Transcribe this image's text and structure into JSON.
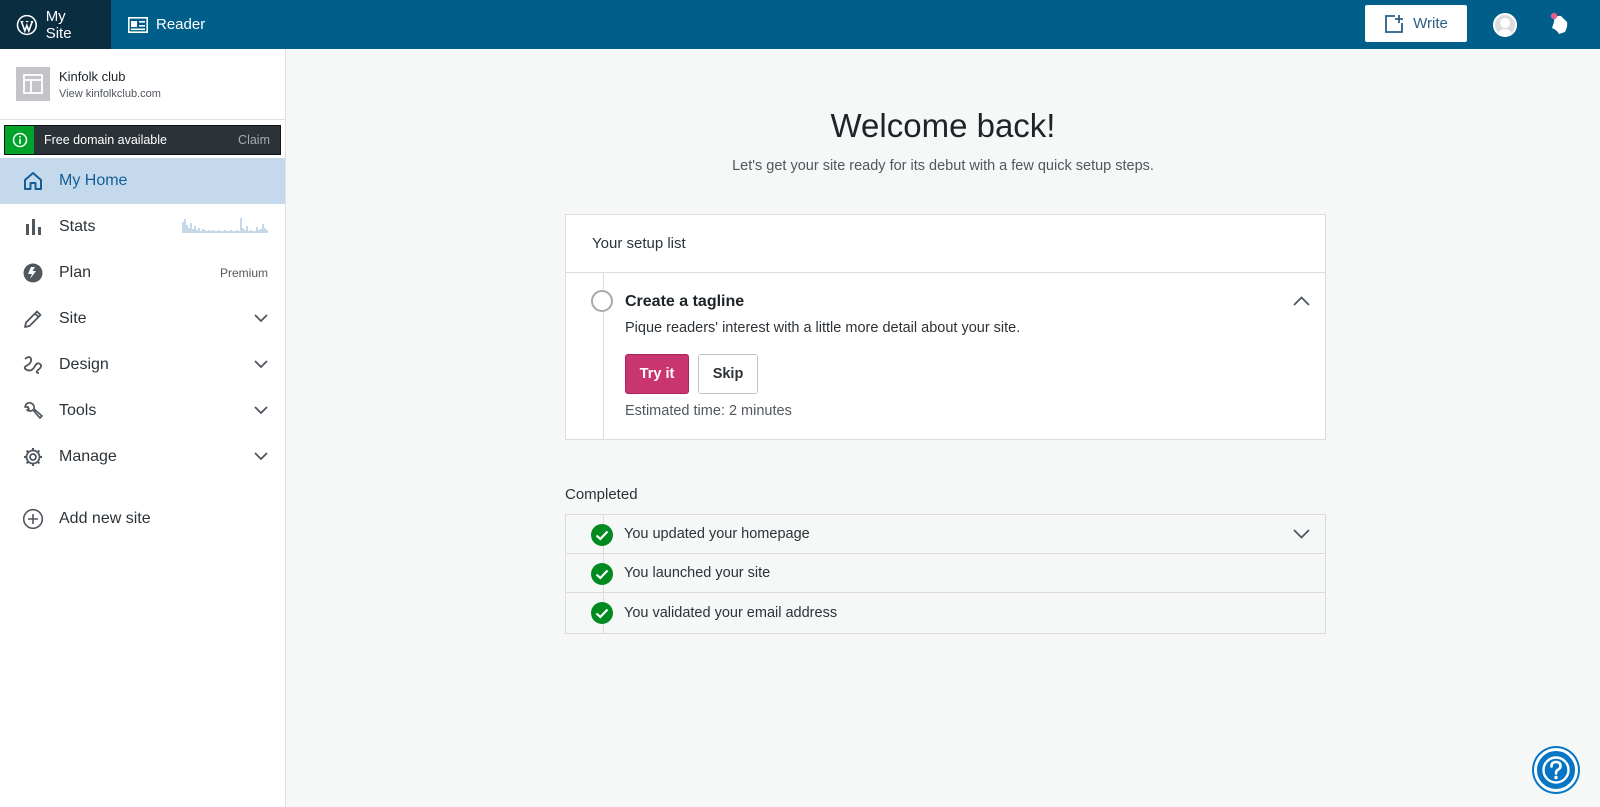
{
  "masterbar": {
    "my_site": "My Site",
    "reader": "Reader",
    "write": "Write"
  },
  "sidebar": {
    "site_name": "Kinfolk club",
    "site_url": "View kinfolkclub.com",
    "domain_banner": {
      "text": "Free domain available",
      "action": "Claim"
    },
    "items": [
      {
        "label": "My Home",
        "icon": "home-icon",
        "active": true
      },
      {
        "label": "Stats",
        "icon": "stats-icon"
      },
      {
        "label": "Plan",
        "icon": "plan-icon",
        "badge": "Premium"
      },
      {
        "label": "Site",
        "icon": "pencil-icon"
      },
      {
        "label": "Design",
        "icon": "design-icon"
      },
      {
        "label": "Tools",
        "icon": "wrench-icon"
      },
      {
        "label": "Manage",
        "icon": "gear-icon"
      }
    ],
    "add_site": "Add new site"
  },
  "main": {
    "title": "Welcome back!",
    "subtitle": "Let's get your site ready for its debut with a few quick setup steps.",
    "setup_card": {
      "header": "Your setup list",
      "task": {
        "title": "Create a tagline",
        "description": "Pique readers' interest with a little more detail about your site.",
        "primary_button": "Try it",
        "secondary_button": "Skip",
        "estimate": "Estimated time: 2 minutes"
      }
    },
    "completed": {
      "label": "Completed",
      "items": [
        "You updated your homepage",
        "You launched your site",
        "You validated your email address"
      ]
    }
  },
  "colors": {
    "masterbar": "#005e8a",
    "masterbar_active": "#0b2d40",
    "accent_pink": "#c9356e",
    "success_green": "#008a20",
    "nav_active_bg": "#c5d9ed"
  }
}
